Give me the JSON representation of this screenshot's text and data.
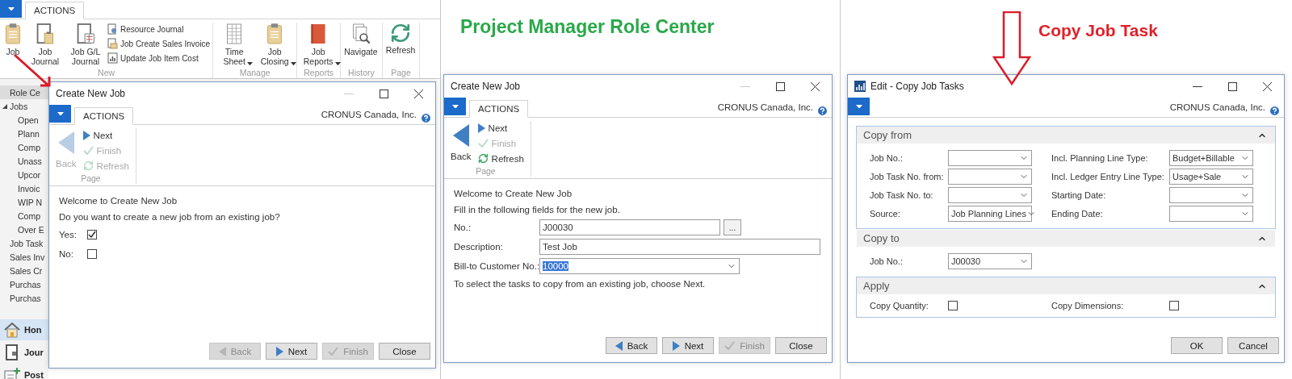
{
  "ribbon": {
    "tabs": [
      {
        "label": "ACTIONS",
        "selected": true
      }
    ],
    "groups": [
      {
        "label": "New",
        "items": [
          {
            "label": "Job",
            "kind": "clipboard",
            "menu": false
          },
          {
            "label": "Job Journal",
            "kind": "journal",
            "menu": false
          },
          {
            "label": "Job G/L Journal",
            "kind": "ledger",
            "menu": false
          }
        ],
        "small_items": [
          {
            "label": "Resource Journal",
            "kind": "resource"
          },
          {
            "label": "Job Create Sales Invoice",
            "kind": "invoice"
          },
          {
            "label": "Update Job Item Cost",
            "kind": "cost"
          }
        ]
      },
      {
        "label": "Manage",
        "items": [
          {
            "label": "Time Sheet",
            "kind": "timesheet",
            "menu": true
          },
          {
            "label": "Job Closing",
            "kind": "clipboard",
            "menu": true
          }
        ]
      },
      {
        "label": "Reports",
        "items": [
          {
            "label": "Job Reports",
            "kind": "book",
            "menu": true
          }
        ]
      },
      {
        "label": "History",
        "items": [
          {
            "label": "Navigate",
            "kind": "navigate",
            "menu": false
          }
        ]
      },
      {
        "label": "Page",
        "items": [
          {
            "label": "Refresh",
            "kind": "refresh",
            "menu": false
          }
        ]
      }
    ]
  },
  "sidebar": {
    "items": [
      {
        "label": "Role Ce",
        "selected": true
      },
      {
        "label": "Jobs",
        "selected": false,
        "expanded": true,
        "children": [
          {
            "label": "Open",
            "selected": false
          },
          {
            "label": "Plann",
            "selected": false
          },
          {
            "label": "Comp",
            "selected": false
          },
          {
            "label": "Unass",
            "selected": false
          },
          {
            "label": "Upcor",
            "selected": false
          },
          {
            "label": "Invoic",
            "selected": false
          },
          {
            "label": "WIP N",
            "selected": false
          },
          {
            "label": "Comp",
            "selected": false
          },
          {
            "label": "Over E",
            "selected": false
          }
        ]
      },
      {
        "label": "Job Task",
        "selected": false
      },
      {
        "label": "Sales Inv",
        "selected": false
      },
      {
        "label": "Sales Cr",
        "selected": false
      },
      {
        "label": "Purchas",
        "selected": false
      },
      {
        "label": "Purchas",
        "selected": false
      }
    ],
    "nav_buttons": [
      {
        "label": "Hon",
        "kind": "home",
        "selected": true
      },
      {
        "label": "Jour",
        "kind": "journal",
        "selected": false
      },
      {
        "label": "Post",
        "kind": "posted",
        "selected": false
      }
    ]
  },
  "headline": "Project Manager Role Center",
  "callout": "Copy Job Task",
  "dialogs": [
    {
      "title": "Create New Job",
      "title_icon": false,
      "can_minimize": false,
      "tabs": [
        {
          "label": "ACTIONS",
          "selected": true
        }
      ],
      "company": "CRONUS Canada, Inc.",
      "action_group": "Page",
      "actions": [
        {
          "label": "Back",
          "kind": "back",
          "disabled": true
        },
        {
          "label": "Next",
          "kind": "next",
          "disabled": false
        },
        {
          "label": "Finish",
          "kind": "finish",
          "disabled": true
        },
        {
          "label": "Refresh",
          "kind": "refresh",
          "disabled": true
        }
      ],
      "content": [
        {
          "kind": "text",
          "text": "Welcome to Create New Job"
        },
        {
          "kind": "text",
          "text": "Do you want to create a new job from an existing job?"
        },
        {
          "kind": "checkbox",
          "label": "Yes:",
          "checked": true
        },
        {
          "kind": "checkbox",
          "label": "No:",
          "checked": false
        }
      ],
      "buttons": [
        {
          "label": "Back",
          "kind": "back",
          "disabled": true
        },
        {
          "label": "Next",
          "kind": "next",
          "disabled": false
        },
        {
          "label": "Finish",
          "kind": "finish",
          "disabled": true
        },
        {
          "label": "Close",
          "kind": "plain",
          "disabled": false
        }
      ]
    },
    {
      "title": "Create New Job",
      "title_icon": false,
      "can_minimize": false,
      "tabs": [
        {
          "label": "ACTIONS",
          "selected": true
        }
      ],
      "company": "CRONUS Canada, Inc.",
      "action_group": "Page",
      "actions": [
        {
          "label": "Back",
          "kind": "back",
          "disabled": false
        },
        {
          "label": "Next",
          "kind": "next",
          "disabled": false
        },
        {
          "label": "Finish",
          "kind": "finish",
          "disabled": true
        },
        {
          "label": "Refresh",
          "kind": "refresh",
          "disabled": false
        }
      ],
      "content": [
        {
          "kind": "text",
          "text": "Welcome to Create New Job"
        },
        {
          "kind": "text",
          "text": "Fill in the following fields for the new job."
        },
        {
          "kind": "lookup_field",
          "label": "No.:",
          "value": "J00030",
          "button_label": "...",
          "highlighted": false
        },
        {
          "kind": "text_field",
          "label": "Description:",
          "value": "Test Job",
          "highlighted": false
        },
        {
          "kind": "dropdown_field",
          "label": "Bill-to Customer No.:",
          "value": "10000",
          "highlighted": true
        },
        {
          "kind": "text",
          "text": "To select the tasks to copy from an existing job, choose Next."
        }
      ],
      "buttons": [
        {
          "label": "Back",
          "kind": "back",
          "disabled": false
        },
        {
          "label": "Next",
          "kind": "next",
          "disabled": false
        },
        {
          "label": "Finish",
          "kind": "finish",
          "disabled": true
        },
        {
          "label": "Close",
          "kind": "plain",
          "disabled": false
        }
      ]
    },
    {
      "title": "Edit - Copy Job Tasks",
      "title_icon": true,
      "can_minimize": true,
      "company": "CRONUS Canada, Inc.",
      "sections": [
        {
          "title": "Copy from",
          "expanded": true,
          "outlined": true,
          "columns": [
            [
              {
                "label": "Job No.:",
                "kind": "dropdown"
              },
              {
                "label": "Job Task No. from:",
                "kind": "dropdown"
              },
              {
                "label": "Job Task No. to:",
                "kind": "dropdown"
              },
              {
                "label": "Source:",
                "kind": "dropdown",
                "value": "Job Planning Lines"
              }
            ],
            [
              {
                "label": "Incl. Planning Line Type:",
                "kind": "dropdown",
                "value": "Budget+Billable"
              },
              {
                "label": "Incl. Ledger Entry Line Type:",
                "kind": "dropdown",
                "value": "Usage+Sale"
              },
              {
                "label": "Starting Date:",
                "kind": "dropdown"
              },
              {
                "label": "Ending Date:",
                "kind": "dropdown"
              }
            ]
          ]
        },
        {
          "title": "Copy to",
          "expanded": true,
          "outlined": false,
          "columns": [
            [
              {
                "label": "Job No.:",
                "kind": "dropdown",
                "value": "J00030"
              }
            ]
          ]
        },
        {
          "title": "Apply",
          "expanded": true,
          "outlined": true,
          "columns": [
            [
              {
                "label": "Copy Quantity:",
                "kind": "checkbox",
                "checked": false
              }
            ],
            [
              {
                "label": "Copy Dimensions:",
                "kind": "checkbox",
                "checked": false
              }
            ]
          ]
        }
      ],
      "buttons": [
        {
          "label": "OK",
          "kind": "plain",
          "disabled": false
        },
        {
          "label": "Cancel",
          "kind": "plain",
          "disabled": false
        }
      ]
    }
  ]
}
